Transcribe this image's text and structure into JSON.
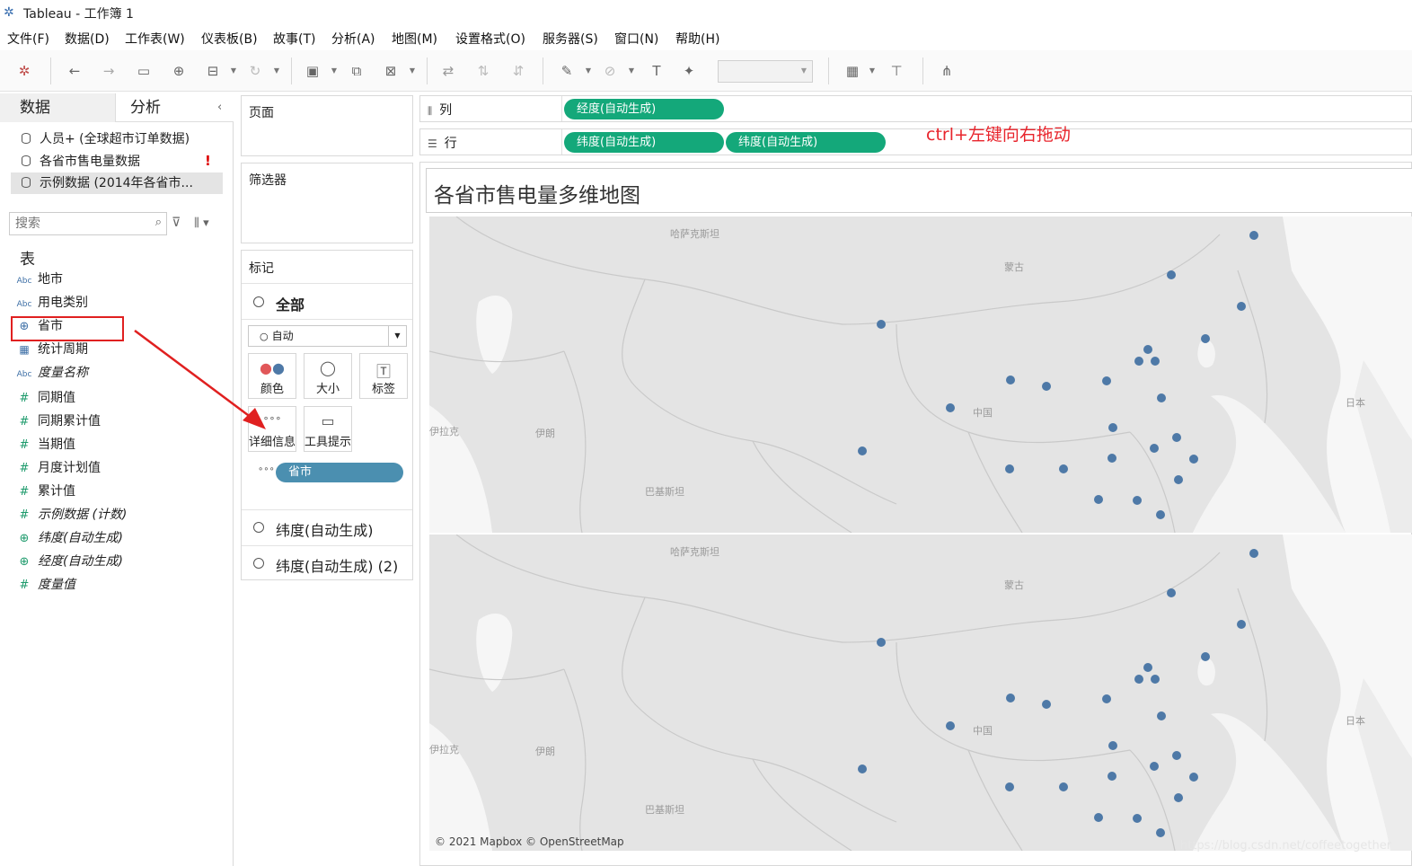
{
  "window": {
    "title": "Tableau - 工作簿 1"
  },
  "menu": [
    "文件(F)",
    "数据(D)",
    "工作表(W)",
    "仪表板(B)",
    "故事(T)",
    "分析(A)",
    "地图(M)",
    "设置格式(O)",
    "服务器(S)",
    "窗口(N)",
    "帮助(H)"
  ],
  "left_pane": {
    "tab_data": "数据",
    "tab_analysis": "分析",
    "datasources": [
      "人员+ (全球超市订单数据)",
      "各省市售电量数据",
      "示例数据 (2014年各省市..."
    ],
    "warning": "!",
    "search_placeholder": "搜索",
    "table_header": "表",
    "fields": [
      {
        "icon": "Abc",
        "name": "地市"
      },
      {
        "icon": "Abc",
        "name": "用电类别"
      },
      {
        "icon": "⊕",
        "name": "省市"
      },
      {
        "icon": "▦",
        "name": "统计周期"
      },
      {
        "icon": "Abc",
        "name": "度量名称"
      },
      {
        "icon": "#",
        "name": "同期值"
      },
      {
        "icon": "#",
        "name": "同期累计值"
      },
      {
        "icon": "#",
        "name": "当期值"
      },
      {
        "icon": "#",
        "name": "月度计划值"
      },
      {
        "icon": "#",
        "name": "累计值"
      },
      {
        "icon": "#",
        "name": "示例数据 (计数)"
      },
      {
        "icon": "⊕",
        "name": "纬度(自动生成)"
      },
      {
        "icon": "⊕",
        "name": "经度(自动生成)"
      },
      {
        "icon": "#",
        "name": "度量值"
      }
    ]
  },
  "pages_card": {
    "title": "页面"
  },
  "filters_card": {
    "title": "筛选器"
  },
  "marks_card": {
    "title": "标记",
    "all_label": "全部",
    "mark_type": "自动",
    "buttons": {
      "color": "颜色",
      "size": "大小",
      "label": "标签",
      "detail": "详细信息",
      "tooltip": "工具提示"
    },
    "detail_pill": "省市",
    "layer1": "纬度(自动生成)",
    "layer2": "纬度(自动生成) (2)"
  },
  "shelves": {
    "columns_label": "列",
    "rows_label": "行",
    "columns_pill": "经度(自动生成)",
    "rows_pill1": "纬度(自动生成)",
    "rows_pill2": "纬度(自动生成)"
  },
  "annotation": "ctrl+左键向右拖动",
  "view": {
    "title": "各省市售电量多维地图",
    "credits": "© 2021 Mapbox © OpenStreetMap",
    "watermark": "https://blog.csdn.net/coffeetogether",
    "map_labels": {
      "kazakhstan": "哈萨克斯坦",
      "mongolia": "蒙古",
      "china": "中国",
      "iraq": "伊拉克",
      "iran": "伊朗",
      "pakistan": "巴基斯坦",
      "japan": "日本"
    },
    "point_color": "#4e79a7"
  }
}
